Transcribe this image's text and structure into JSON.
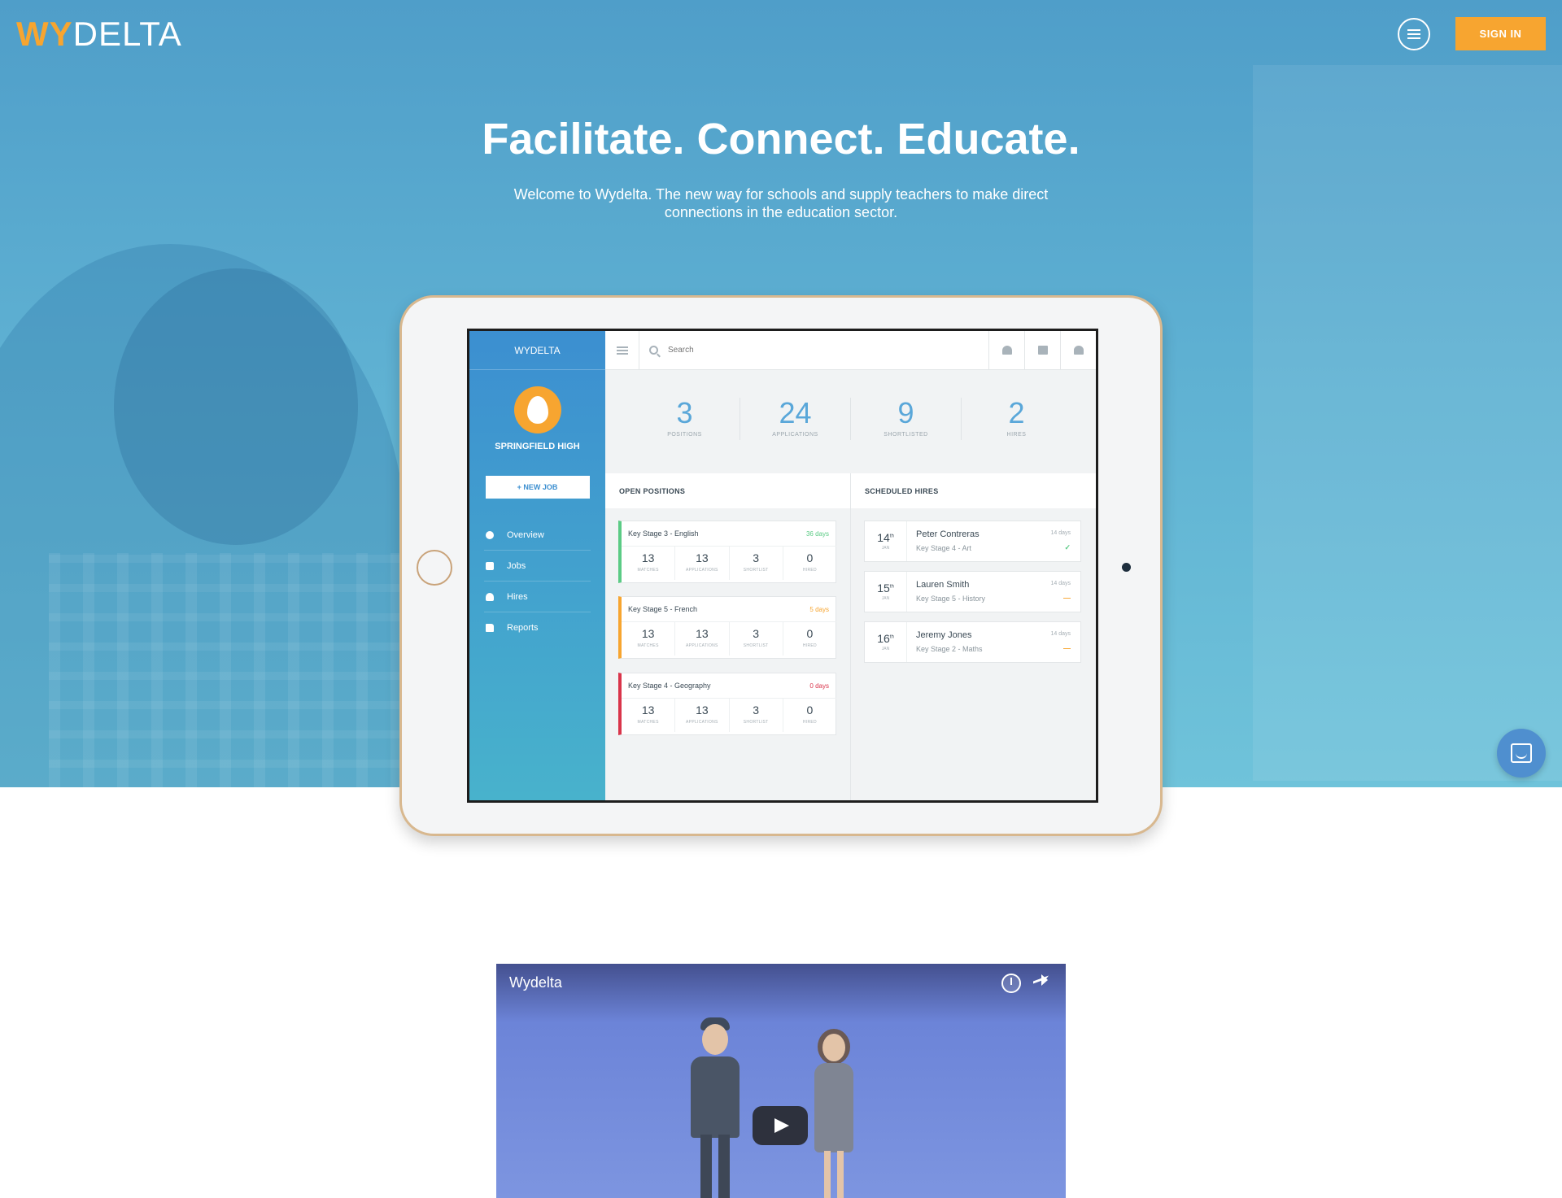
{
  "brand": {
    "wy": "WY",
    "delta": "DELTA"
  },
  "header": {
    "signin_label": "SIGN IN"
  },
  "hero": {
    "headline": "Facilitate. Connect. Educate.",
    "subline": "Welcome to Wydelta. The new way for schools and supply teachers to make direct connections in the education sector."
  },
  "app": {
    "logo": "WYDELTA",
    "school_name": "SPRINGFIELD HIGH",
    "new_job_label": "+ NEW JOB",
    "nav": [
      {
        "label": "Overview",
        "icon": "dashboard-icon"
      },
      {
        "label": "Jobs",
        "icon": "briefcase-icon"
      },
      {
        "label": "Hires",
        "icon": "user-icon"
      },
      {
        "label": "Reports",
        "icon": "folder-icon"
      }
    ],
    "search_placeholder": "Search",
    "stats": [
      {
        "value": "3",
        "label": "POSITIONS"
      },
      {
        "value": "24",
        "label": "APPLICATIONS"
      },
      {
        "value": "9",
        "label": "SHORTLISTED"
      },
      {
        "value": "2",
        "label": "HIRES"
      }
    ],
    "open_positions_title": "OPEN POSITIONS",
    "scheduled_hires_title": "SCHEDULED HIRES",
    "jobs": [
      {
        "title": "Key Stage 3 - English",
        "days": "36 days",
        "color": "#5bcb85",
        "matches": "13",
        "applications": "13",
        "shortlist": "3",
        "hired": "0"
      },
      {
        "title": "Key Stage 5 - French",
        "days": "5 days",
        "color": "#f7a530",
        "matches": "13",
        "applications": "13",
        "shortlist": "3",
        "hired": "0"
      },
      {
        "title": "Key Stage 4 - Geography",
        "days": "0 days",
        "color": "#d9344a",
        "matches": "13",
        "applications": "13",
        "shortlist": "3",
        "hired": "0"
      }
    ],
    "job_cell_labels": {
      "matches": "MATCHES",
      "applications": "APPLICATIONS",
      "shortlist": "SHORTLIST",
      "hired": "HIRED"
    },
    "hires": [
      {
        "day": "14",
        "suffix": "th",
        "month": "JAN",
        "name": "Peter Contreras",
        "subject": "Key Stage 4 - Art",
        "days": "14 days",
        "mark": "✓",
        "mark_color": "#5bcb85"
      },
      {
        "day": "15",
        "suffix": "th",
        "month": "JAN",
        "name": "Lauren Smith",
        "subject": "Key Stage 5 - History",
        "days": "14 days",
        "mark": "—",
        "mark_color": "#f7a530"
      },
      {
        "day": "16",
        "suffix": "th",
        "month": "JAN",
        "name": "Jeremy Jones",
        "subject": "Key Stage 2 - Maths",
        "days": "14 days",
        "mark": "—",
        "mark_color": "#f7a530"
      }
    ]
  },
  "video": {
    "title": "Wydelta"
  },
  "colors": {
    "accent": "#f7a530",
    "hero": "#5eb0d2",
    "stat_blue": "#5aa7d9"
  }
}
